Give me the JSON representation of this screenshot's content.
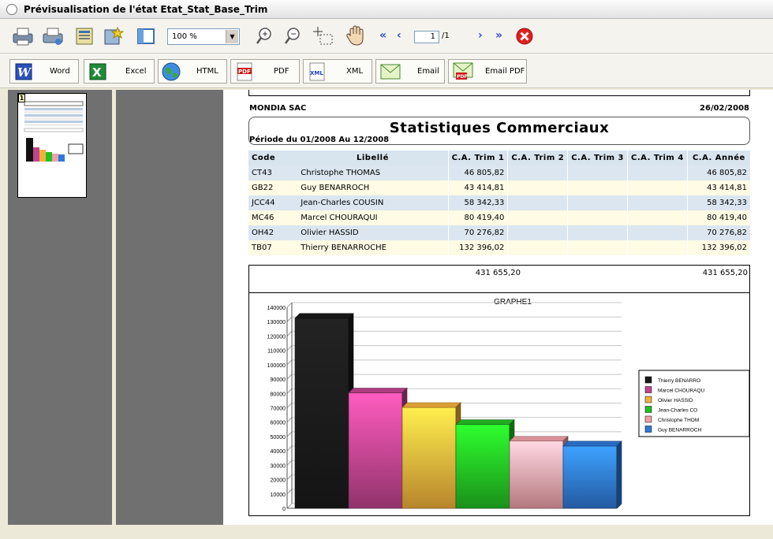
{
  "window": {
    "title": "Prévisualisation de l'état Etat_Stat_Base_Trim"
  },
  "toolbar": {
    "zoom_value": "100 %",
    "page_current": "1",
    "page_total": "/1",
    "first_label": "«",
    "prev_label": "‹",
    "next_label": "›",
    "last_label": "»"
  },
  "exports": [
    {
      "label": "Word",
      "icon": "word-icon"
    },
    {
      "label": "Excel",
      "icon": "excel-icon"
    },
    {
      "label": "HTML",
      "icon": "globe-icon"
    },
    {
      "label": "PDF",
      "icon": "pdf-icon"
    },
    {
      "label": "XML",
      "icon": "xml-icon"
    },
    {
      "label": "Email",
      "icon": "envelope-icon"
    },
    {
      "label": "Email PDF",
      "icon": "email-pdf-icon"
    }
  ],
  "thumbnail": {
    "page_number": "1"
  },
  "report": {
    "company": "MONDIA SAC",
    "date": "26/02/2008",
    "title": "Statistiques Commerciaux",
    "period": "Période du 01/2008 Au 12/2008",
    "columns": [
      "Code",
      "Libellé",
      "C.A. Trim 1",
      "C.A. Trim 2",
      "C.A. Trim 3",
      "C.A. Trim 4",
      "C.A. Année"
    ],
    "rows": [
      {
        "code": "CT43",
        "name": "Christophe THOMAS",
        "t1": "46 805,82",
        "t2": "",
        "t3": "",
        "t4": "",
        "year": "46 805,82"
      },
      {
        "code": "GB22",
        "name": "Guy BENARROCH",
        "t1": "43 414,81",
        "t2": "",
        "t3": "",
        "t4": "",
        "year": "43 414,81"
      },
      {
        "code": "JCC44",
        "name": "Jean-Charles COUSIN",
        "t1": "58 342,33",
        "t2": "",
        "t3": "",
        "t4": "",
        "year": "58 342,33"
      },
      {
        "code": "MC46",
        "name": "Marcel CHOURAQUI",
        "t1": "80 419,40",
        "t2": "",
        "t3": "",
        "t4": "",
        "year": "80 419,40"
      },
      {
        "code": "OH42",
        "name": "Olivier HASSID",
        "t1": "70 276,82",
        "t2": "",
        "t3": "",
        "t4": "",
        "year": "70 276,82"
      },
      {
        "code": "TB07",
        "name": "Thierry BENARROCHE",
        "t1": "132 396,02",
        "t2": "",
        "t3": "",
        "t4": "",
        "year": "132 396,02"
      }
    ],
    "total_t1": "431 655,20",
    "total_year": "431 655,20"
  },
  "chart_data": {
    "type": "bar",
    "title": "GRAPHE1",
    "categories": [
      "Thierry BENARRO",
      "Marcel CHOURAQU",
      "Olivier HASSID",
      "Jean-Charles CO",
      "Christophe THOM",
      "Guy BENARROCH"
    ],
    "values": [
      132396.02,
      80419.4,
      70276.82,
      58342.33,
      46805.82,
      43414.81
    ],
    "colors": [
      "#1a1a1a",
      "#c0448e",
      "#f4b13a",
      "#22c022",
      "#f0a0a8",
      "#2e78d8"
    ],
    "ylim": [
      0,
      140000
    ],
    "yticks": [
      "0",
      "10000",
      "20000",
      "30000",
      "40000",
      "50000",
      "60000",
      "70000",
      "80000",
      "90000",
      "100000",
      "110000",
      "120000",
      "130000",
      "140000"
    ],
    "legend_position": "right",
    "grid": true
  }
}
